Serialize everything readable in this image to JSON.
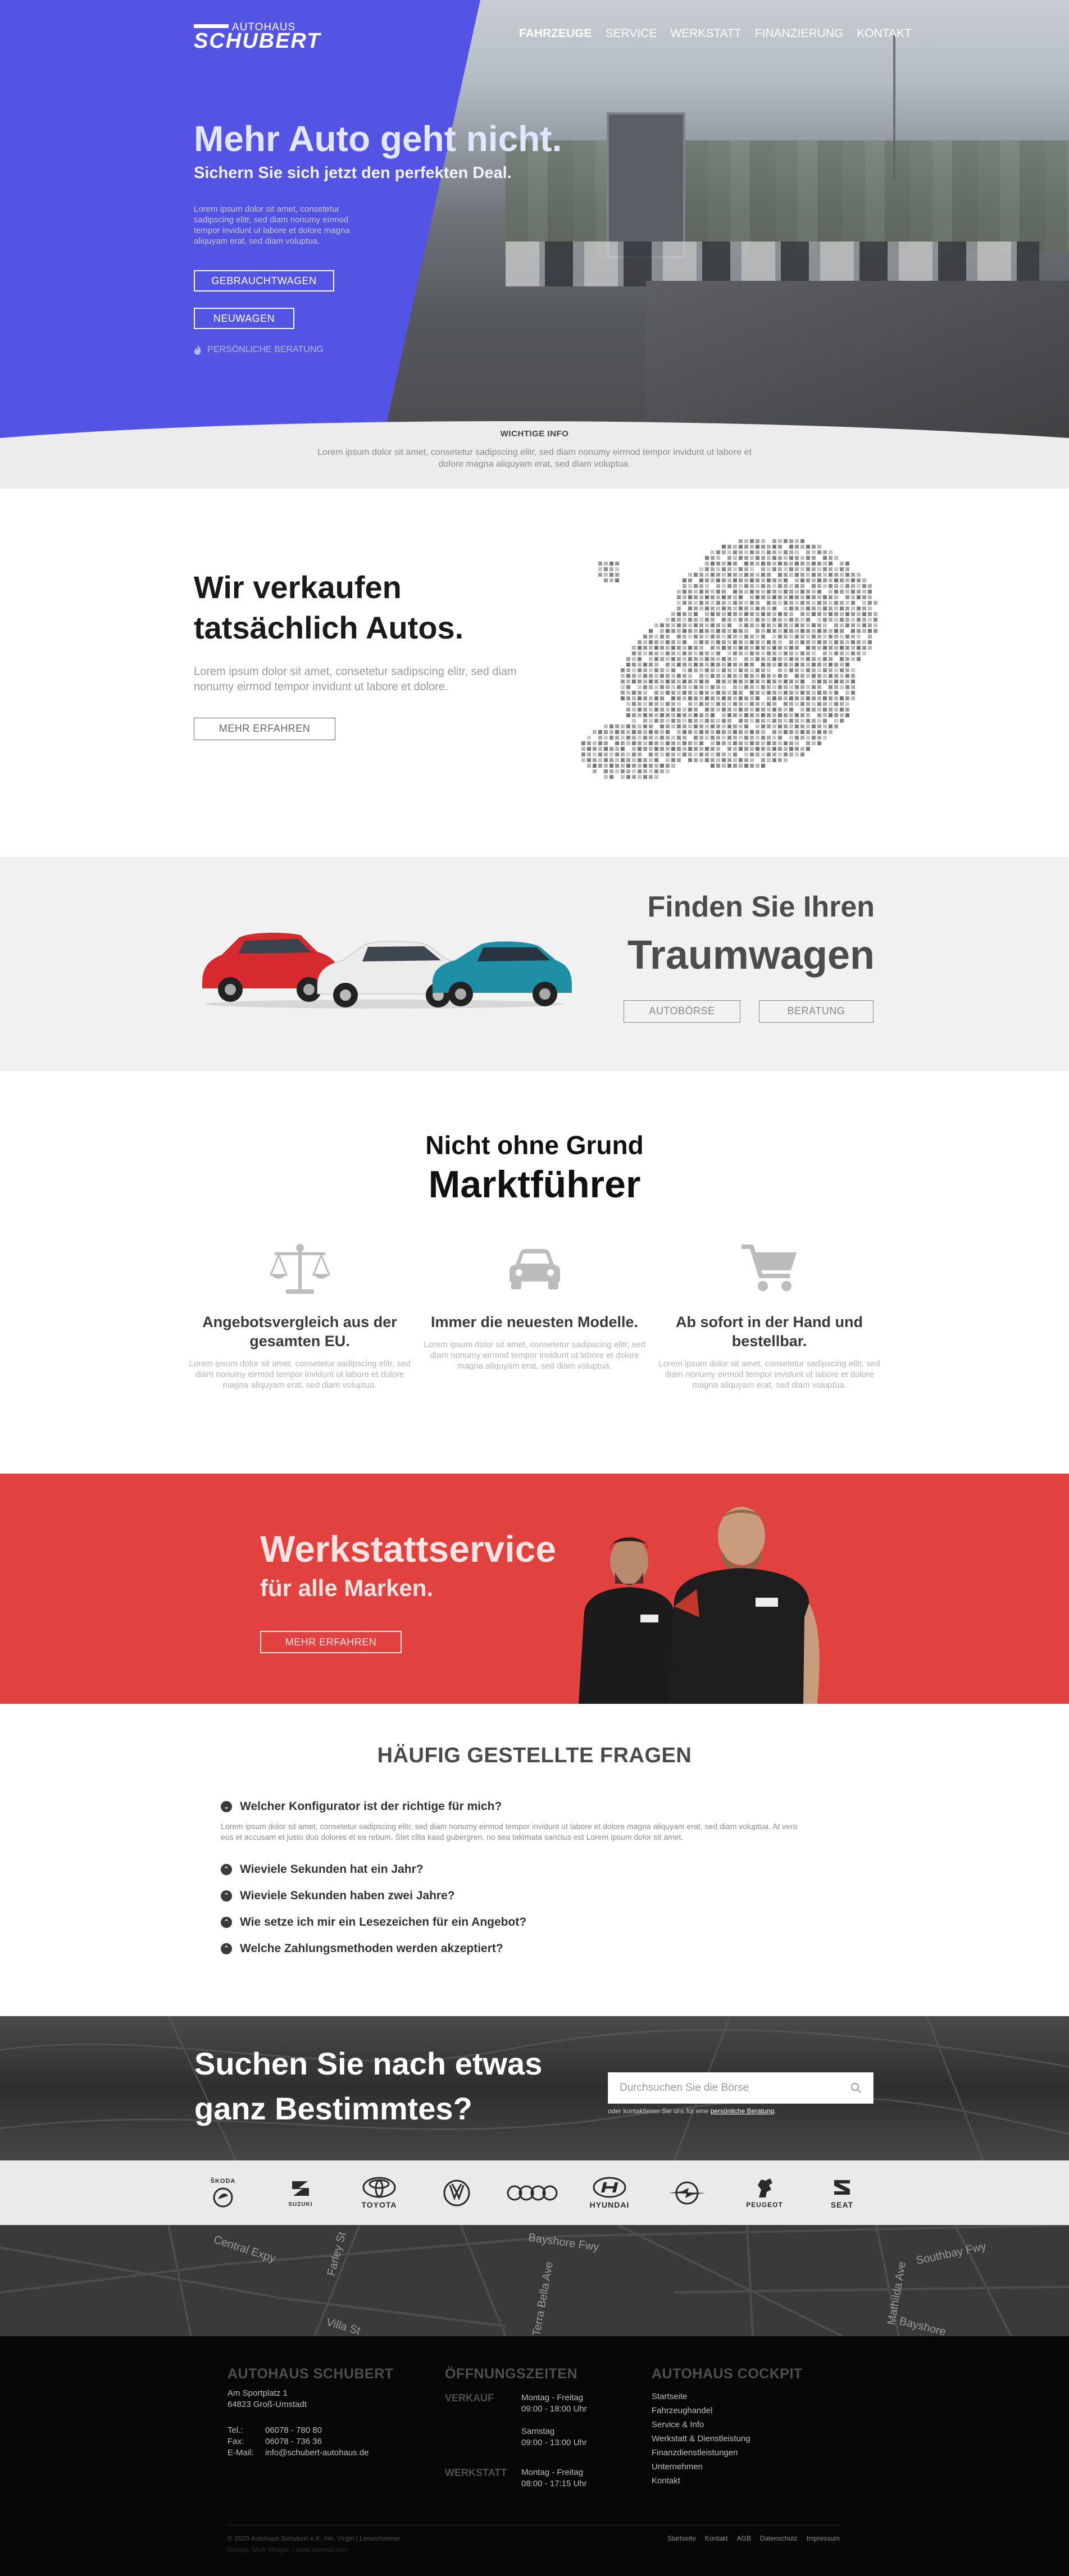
{
  "colors": {
    "brand_blue": "#5353e4",
    "workshop_red": "#e2423f",
    "footer_black": "#070707",
    "light_gray": "#f1f1f1"
  },
  "logo": {
    "line1": "AUTOHAUS",
    "line2": "SCHUBERT"
  },
  "nav": [
    {
      "label": "FAHRZEUGE",
      "active": true
    },
    {
      "label": "SERVICE"
    },
    {
      "label": "WERKSTATT"
    },
    {
      "label": "FINANZIERUNG"
    },
    {
      "label": "KONTAKT"
    }
  ],
  "hero": {
    "title": "Mehr Auto geht nicht.",
    "subtitle": "Sichern Sie sich jetzt den perfekten Deal.",
    "text": "Lorem ipsum dolor sit amet, consetetur sadipscing elitr, sed diam nonumy eirmod tempor invidunt ut labore et dolore magna aliquyam erat, sed diam voluptua.",
    "btn_used": "GEBRAUCHTWAGEN",
    "btn_new": "NEUWAGEN",
    "personal": "PERSÖNLICHE BERATUNG",
    "info_title": "WICHTIGE INFO",
    "info_text": "Lorem ipsum dolor sit amet, consetetur sadipscing elitr, sed diam nonumy eirmod tempor invidunt ut labore et dolore magna aliquyam erat, sed diam voluptua."
  },
  "sell": {
    "title": "Wir verkaufen tatsächlich Autos.",
    "text": "Lorem ipsum dolor sit amet, consetetur sadipscing elitr, sed diam nonumy eirmod tempor invidunt ut labore et dolore.",
    "button": "MEHR ERFAHREN"
  },
  "dream": {
    "title1": "Finden Sie Ihren",
    "title2": "Traumwagen",
    "btn1": "AUTOBÖRSE",
    "btn2": "BERATUNG"
  },
  "leader": {
    "title1": "Nicht ohne Grund",
    "title2": "Marktführer",
    "features": [
      {
        "icon": "scale-icon",
        "title": "Angebotsvergleich aus der gesamten EU.",
        "text": "Lorem ipsum dolor sit amet, consetetur sadipscing elitr, sed diam nonumy eirmod tempor invidunt ut labore et dolore magna aliquyam erat, sed diam voluptua."
      },
      {
        "icon": "car-icon",
        "title": "Immer die neuesten Modelle.",
        "text": "Lorem ipsum dolor sit amet, consetetur sadipscing elitr, sed diam nonumy eirmod tempor invidunt ut labore et dolore magna aliquyam erat, sed diam voluptua."
      },
      {
        "icon": "cart-icon",
        "title": "Ab sofort in der Hand und bestellbar.",
        "text": "Lorem ipsum dolor sit amet, consetetur sadipscing elitr, sed diam nonumy eirmod tempor invidunt ut labore et dolore magna aliquyam erat, sed diam voluptua."
      }
    ]
  },
  "workshop": {
    "title1": "Werkstattservice",
    "title2": "für alle Marken.",
    "button": "MEHR ERFAHREN"
  },
  "faq": {
    "title": "HÄUFIG GESTELLTE FRAGEN",
    "questions": [
      "Welcher Konfigurator ist der richtige für mich?",
      "Wieviele Sekunden hat ein Jahr?",
      "Wieviele Sekunden haben zwei Jahre?",
      "Wie setze ich mir ein Lesezeichen für ein Angebot?",
      "Welche Zahlungsmethoden werden akzeptiert?"
    ],
    "answer": "Lorem ipsum dolor sit amet, consetetur sadipscing elitr, sed diam nonumy eirmod tempor invidunt ut labore et dolore magna aliquyam erat, sed diam voluptua. At vero eos et accusam et justo duo dolores et ea rebum. Stet clita kasd gubergren, no sea takimata sanctus est Lorem ipsum dolor sit amet."
  },
  "search": {
    "title": "Suchen Sie nach etwas ganz Bestimmtes?",
    "placeholder": "Durchsuchen Sie die Börse",
    "hint_prefix": "oder kontaktieren Sie uns für eine ",
    "hint_link": "persönliche Beratung",
    "hint_suffix": "."
  },
  "brands": [
    {
      "name": "ŠKODA",
      "icon": "skoda-logo-icon"
    },
    {
      "name": "SUZUKI",
      "icon": "suzuki-logo-icon"
    },
    {
      "name": "TOYOTA",
      "icon": "toyota-logo-icon"
    },
    {
      "name": "",
      "icon": "vw-logo-icon"
    },
    {
      "name": "",
      "icon": "audi-logo-icon"
    },
    {
      "name": "HYUNDAI",
      "icon": "hyundai-logo-icon"
    },
    {
      "name": "",
      "icon": "opel-logo-icon"
    },
    {
      "name": "PEUGEOT",
      "icon": "peugeot-logo-icon"
    },
    {
      "name": "SEAT",
      "icon": "seat-logo-icon"
    }
  ],
  "map_streets": [
    "Central Expy",
    "Farley St",
    "Bayshore Fwy",
    "Terra Bella Ave",
    "Mathilda Ave",
    "Southbay Fwy",
    "Villa St",
    "Bayshore"
  ],
  "footer": {
    "company": {
      "title": "AUTOHAUS SCHUBERT",
      "street": "Am Sportplatz 1",
      "city": "64823 Groß-Umstadt",
      "tel_label": "Tel.:",
      "tel": "06078 - 780 80",
      "fax_label": "Fax:",
      "fax": "06078 - 736 36",
      "mail_label": "E-Mail:",
      "mail": "info@schubert-autohaus.de"
    },
    "hours": {
      "title": "ÖFFNUNGSZEITEN",
      "sales_label": "VERKAUF",
      "sales_weekday": "Montag - Freitag",
      "sales_weekday_time": "09:00 - 18:00 Uhr",
      "sales_sat": "Samstag",
      "sales_sat_time": "09:00 - 13:00 Uhr",
      "workshop_label": "WERKSTATT",
      "workshop_weekday": "Montag - Freitag",
      "workshop_weekday_time": "08:00 - 17:15 Uhr"
    },
    "cockpit": {
      "title": "AUTOHAUS COCKPIT",
      "links": [
        "Startseite",
        "Fahrzeughandel",
        "Service & Info",
        "Werkstatt & Dienstleistung",
        "Finanzdienstleistungen",
        "Unternehmen",
        "Kontakt"
      ]
    },
    "copyright": "© 2020 Autohaus Schubert e.K. Inh. Virgin | Leisenheimer",
    "credit": "Design: Mick Meigen | www.akmedi.com",
    "legal": [
      "Startseite",
      "Kontakt",
      "AGB",
      "Datenschutz",
      "Impressum"
    ]
  }
}
